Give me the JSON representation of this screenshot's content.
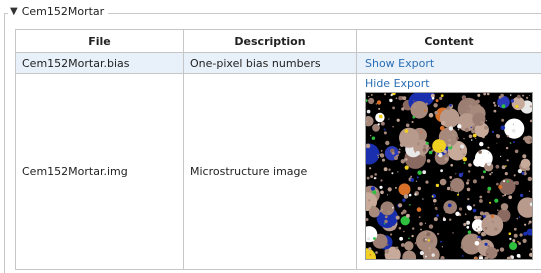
{
  "section": {
    "title": "Cem152Mortar",
    "toggle_icon": "triangle-down-icon"
  },
  "table": {
    "headers": {
      "file": "File",
      "description": "Description",
      "content": "Content"
    },
    "rows": [
      {
        "file": "Cem152Mortar.bias",
        "description": "One-pixel bias numbers",
        "content_link": "Show Export"
      },
      {
        "file": "Cem152Mortar.img",
        "description": "Microstructure image",
        "content_link": "Hide Export",
        "image": "microstructure-image"
      }
    ]
  },
  "colors": {
    "link": "#2a6fb5",
    "selected_row": "#e8f0fa",
    "border": "#c6c6c6"
  }
}
